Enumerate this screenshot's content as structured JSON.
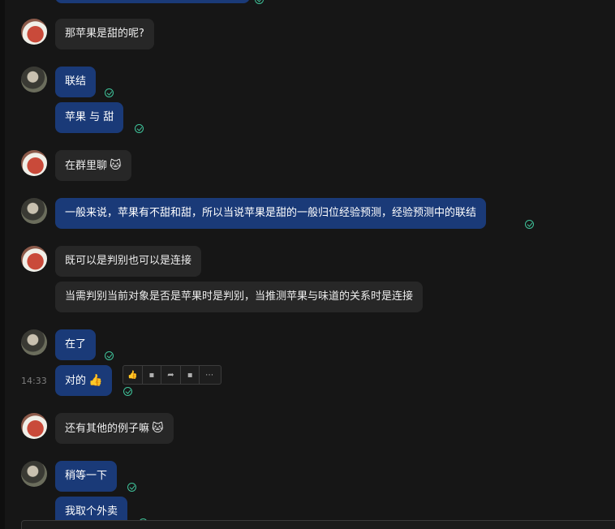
{
  "messages": {
    "m1": "那苹果是甜的呢?",
    "m2": "联结",
    "m3": "苹果 与 甜",
    "m4": "在群里聊",
    "m5": "一般来说，苹果有不甜和甜，所以当说苹果是甜的一般归位经验预测，经验预测中的联结",
    "m6": "既可以是判别也可以是连接",
    "m7": "当需判别当前对象是否是苹果时是判别，当推测苹果与味道的关系时是连接",
    "m8": "在了",
    "m9": "对的",
    "m10": "还有其他的例子嘛",
    "m11": "稍等一下",
    "m12": "我取个外卖"
  },
  "emojis": {
    "cat": "🐱",
    "thumbs_up": "👍"
  },
  "hover_time": "14:33",
  "action_bar": {
    "like_icon": "👍",
    "comment_icon": "▪",
    "forward_icon": "➦",
    "quote_icon": "▪",
    "more_icon": "⋯"
  },
  "colors": {
    "background": "#161616",
    "incoming_bubble": "#272727",
    "outgoing_bubble": "#1a3a78",
    "read_check": "#3fc39a"
  }
}
